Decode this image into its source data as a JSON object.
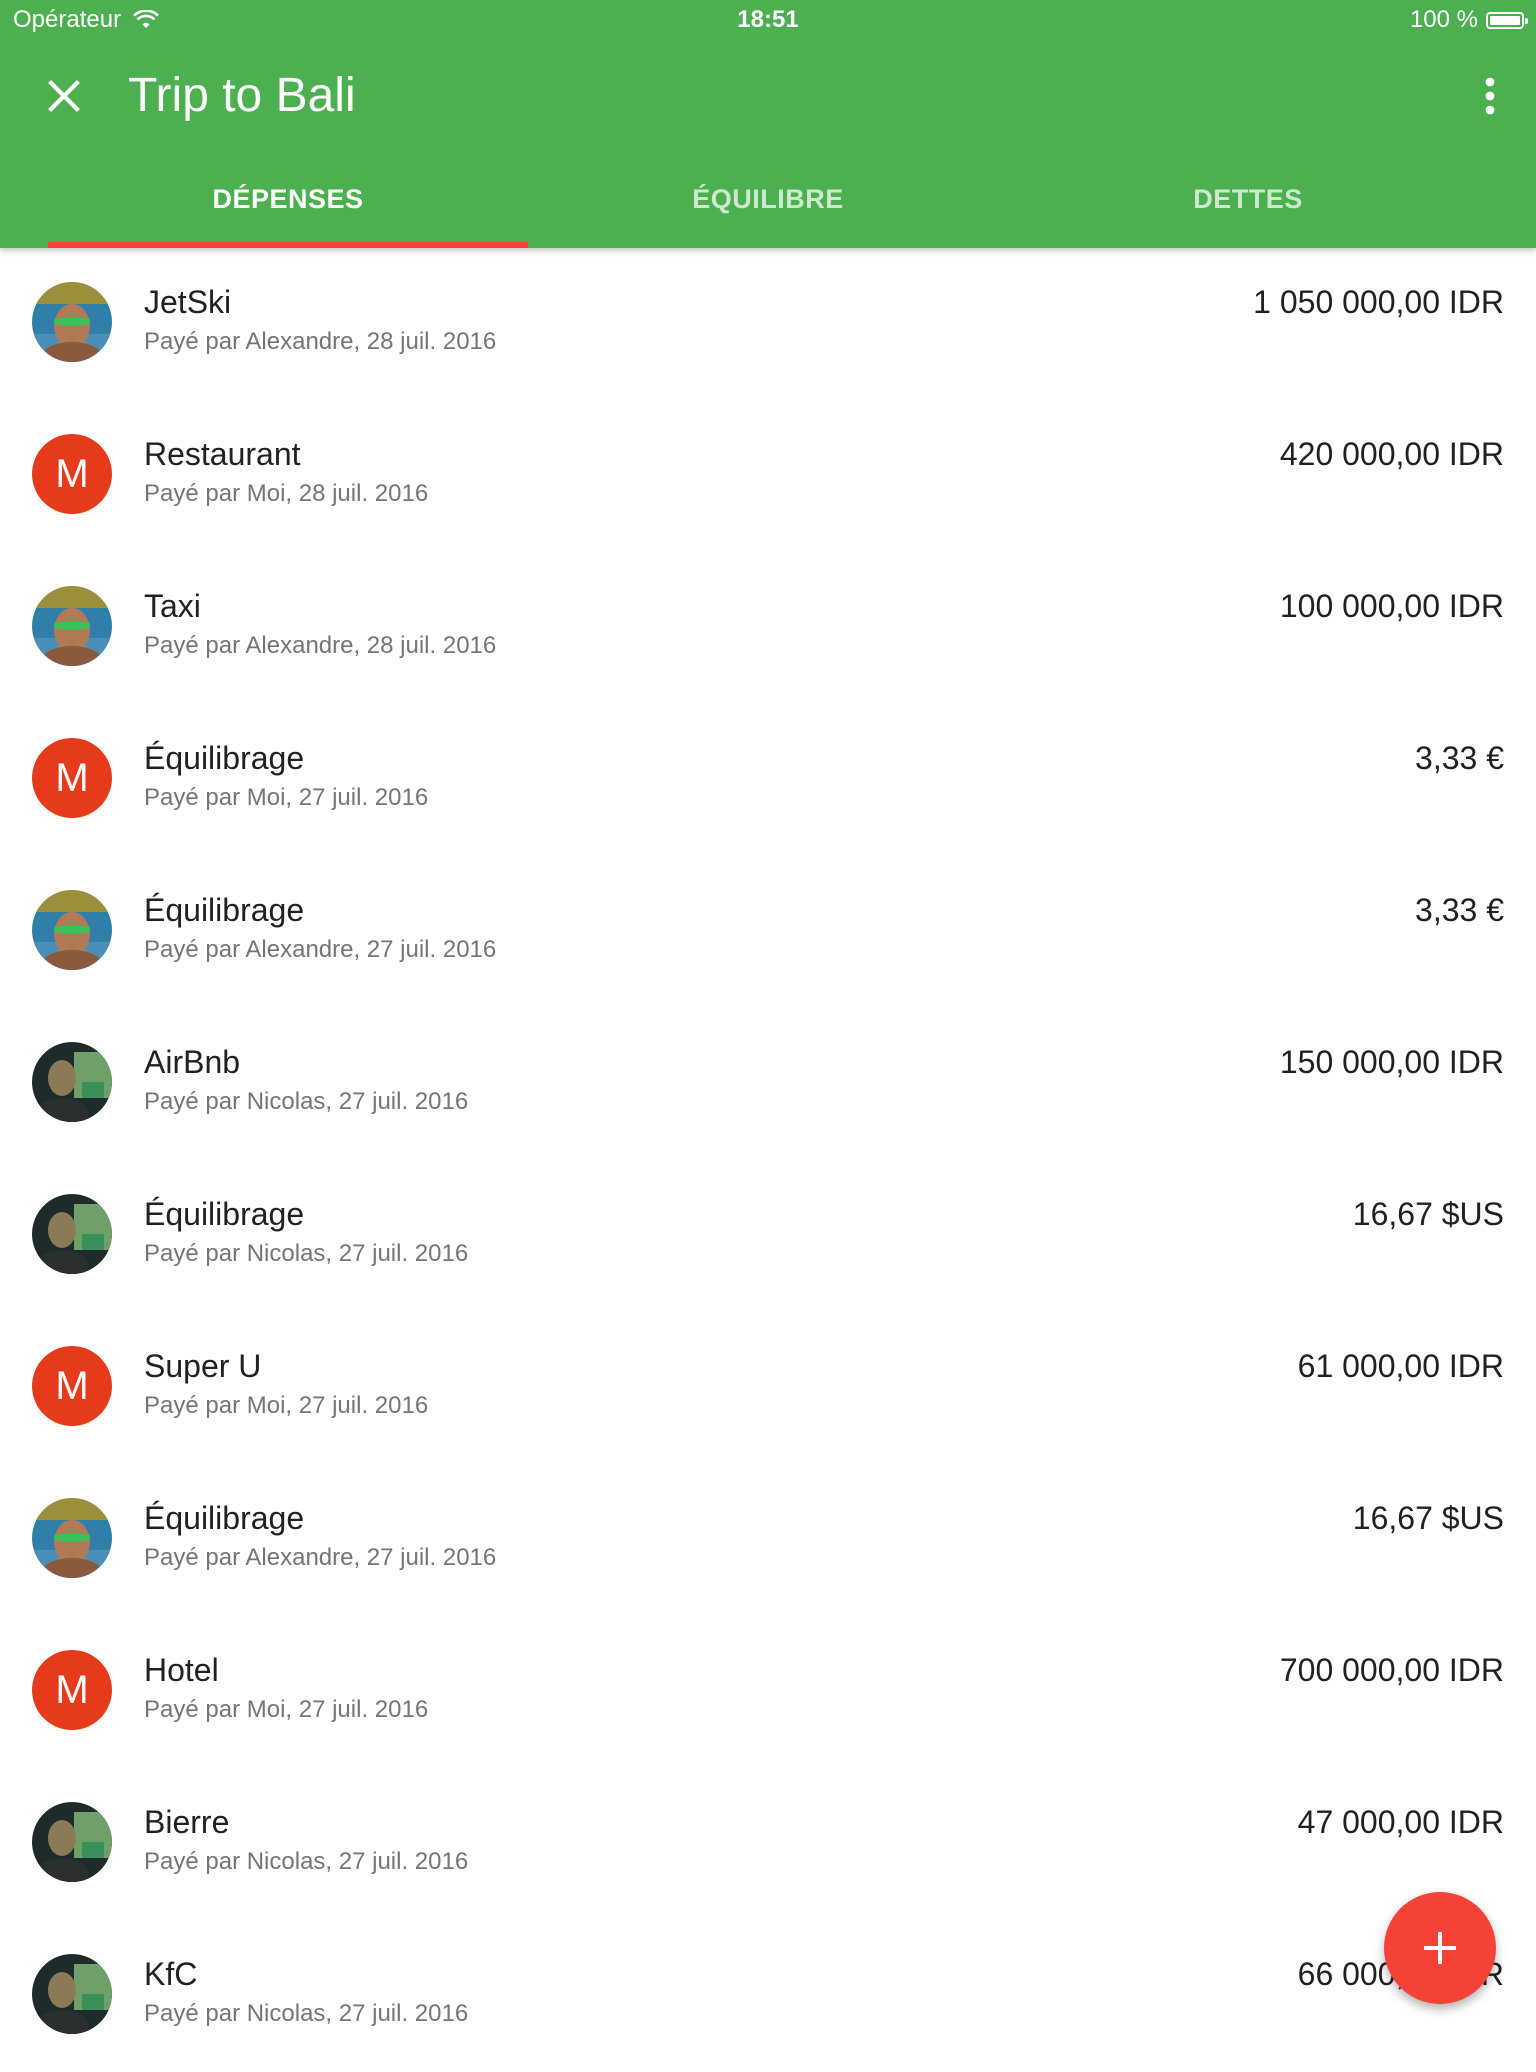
{
  "status_bar": {
    "carrier": "Opérateur",
    "time": "18:51",
    "battery": "100 %"
  },
  "toolbar": {
    "title": "Trip to Bali",
    "close_icon": "close-icon",
    "more_icon": "more-vert-icon"
  },
  "tabs": [
    {
      "label": "DÉPENSES",
      "active": true
    },
    {
      "label": "ÉQUILIBRE",
      "active": false
    },
    {
      "label": "DETTES",
      "active": false
    }
  ],
  "colors": {
    "primary": "#4caf50",
    "accent": "#f44336",
    "avatar_letter_bg": "#e53b1b"
  },
  "expenses": [
    {
      "title": "JetSki",
      "subtitle": "Payé par Alexandre, 28 juil. 2016",
      "amount": "1 050 000,00 IDR",
      "avatar": "photo-alexandre"
    },
    {
      "title": "Restaurant",
      "subtitle": "Payé par Moi, 28 juil. 2016",
      "amount": "420 000,00 IDR",
      "avatar": "letter",
      "avatar_letter": "M"
    },
    {
      "title": "Taxi",
      "subtitle": "Payé par Alexandre, 28 juil. 2016",
      "amount": "100 000,00 IDR",
      "avatar": "photo-alexandre"
    },
    {
      "title": "Équilibrage",
      "subtitle": "Payé par Moi, 27 juil. 2016",
      "amount": "3,33 €",
      "avatar": "letter",
      "avatar_letter": "M"
    },
    {
      "title": "Équilibrage",
      "subtitle": "Payé par Alexandre, 27 juil. 2016",
      "amount": "3,33 €",
      "avatar": "photo-alexandre"
    },
    {
      "title": "AirBnb",
      "subtitle": "Payé par Nicolas, 27 juil. 2016",
      "amount": "150 000,00 IDR",
      "avatar": "photo-nicolas"
    },
    {
      "title": "Équilibrage",
      "subtitle": "Payé par Nicolas, 27 juil. 2016",
      "amount": "16,67 $US",
      "avatar": "photo-nicolas"
    },
    {
      "title": "Super U",
      "subtitle": "Payé par Moi, 27 juil. 2016",
      "amount": "61 000,00 IDR",
      "avatar": "letter",
      "avatar_letter": "M"
    },
    {
      "title": "Équilibrage",
      "subtitle": "Payé par Alexandre, 27 juil. 2016",
      "amount": "16,67 $US",
      "avatar": "photo-alexandre"
    },
    {
      "title": "Hotel",
      "subtitle": "Payé par Moi, 27 juil. 2016",
      "amount": "700 000,00 IDR",
      "avatar": "letter",
      "avatar_letter": "M"
    },
    {
      "title": "Bierre",
      "subtitle": "Payé par Nicolas, 27 juil. 2016",
      "amount": "47 000,00 IDR",
      "avatar": "photo-nicolas"
    },
    {
      "title": "KfC",
      "subtitle": "Payé par Nicolas, 27 juil. 2016",
      "amount": "66 000,00 IDR",
      "avatar": "photo-nicolas"
    }
  ],
  "fab": {
    "icon": "add-icon"
  }
}
